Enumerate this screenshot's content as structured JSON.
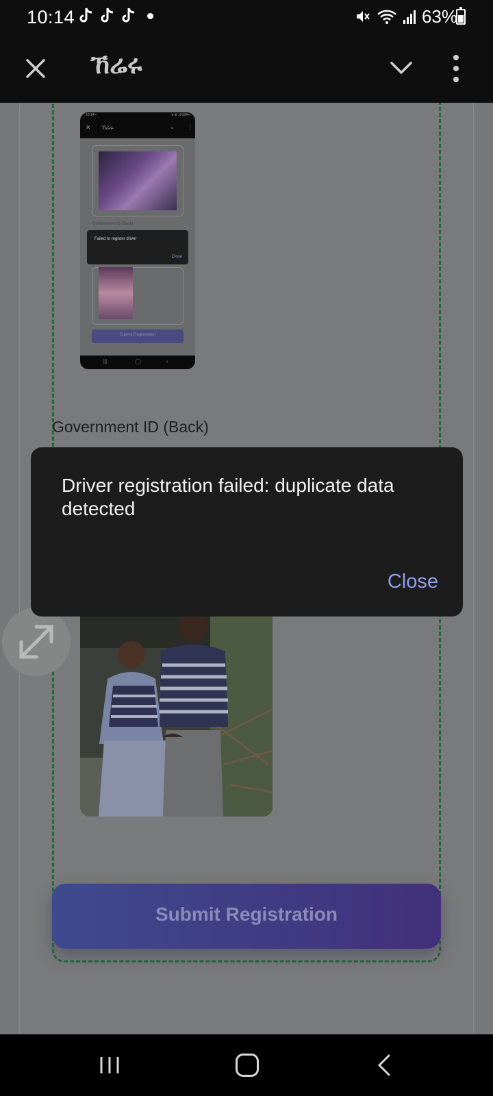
{
  "status_bar": {
    "time": "10:14",
    "battery": "63%",
    "icons": [
      "tiktok-icon",
      "tiktok-icon",
      "tiktok-icon",
      "notification-dot",
      "mute-icon",
      "wifi-icon",
      "signal-icon",
      "battery-icon"
    ]
  },
  "app_bar": {
    "title": "ኸሬሩ",
    "icons": [
      "close-icon",
      "chevron-down-icon",
      "more-vert-icon"
    ]
  },
  "form": {
    "section_label": "Government ID (Back)",
    "submit_label": "Submit Registration"
  },
  "thumbnail": {
    "label": "Government ID (Back)",
    "dialog_text": "Failed to register driver",
    "dialog_close": "Close",
    "submit_label": "Submit Registration"
  },
  "dialog": {
    "message": "Driver registration failed: duplicate data detected",
    "close_label": "Close"
  },
  "colors": {
    "dialog_bg": "#1c1c1c",
    "accent": "#8f9eee",
    "dropzone_border": "#1f6a3b",
    "submit_gradient_start": "#3e4a8e",
    "submit_gradient_end": "#42307a"
  }
}
